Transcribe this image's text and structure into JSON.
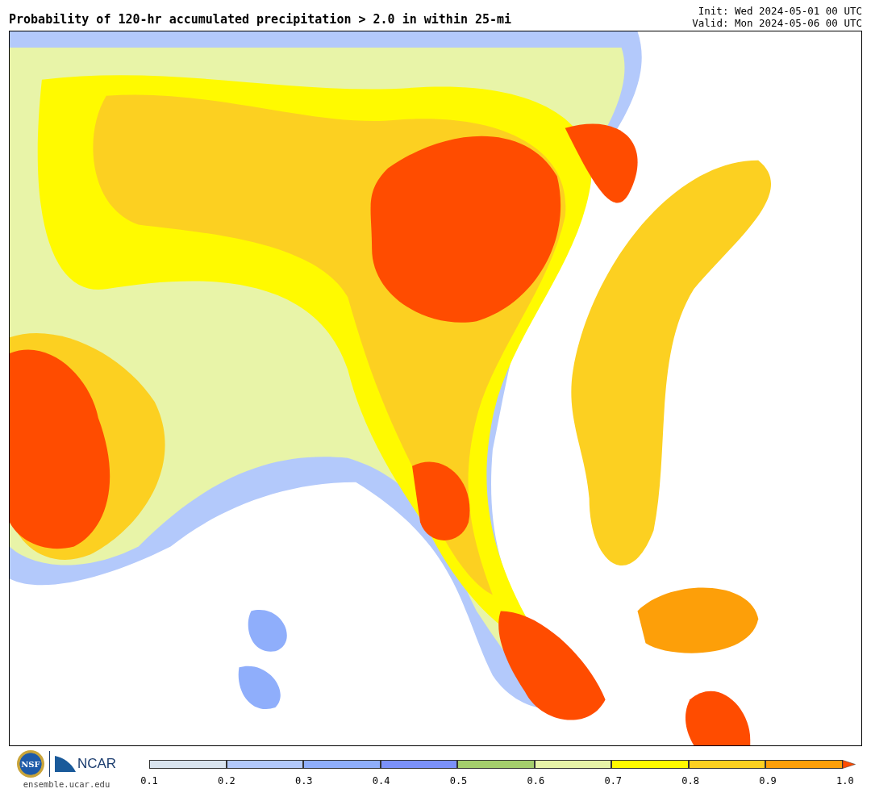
{
  "title": "Probability of 120-hr accumulated precipitation > 2.0 in within 25-mi",
  "init": "Init: Wed 2024-05-01 00 UTC",
  "valid": "Valid: Mon 2024-05-06 00 UTC",
  "logos": {
    "nsf": "NSF",
    "ncar": "NCAR",
    "site": "ensemble.ucar.edu"
  },
  "colorbar": {
    "segments": [
      {
        "color": "#d9e4ef"
      },
      {
        "color": "#b3c9fb"
      },
      {
        "color": "#8faefb"
      },
      {
        "color": "#7b91f9"
      },
      {
        "color": "#a4ce6c"
      },
      {
        "color": "#e8f4a8"
      },
      {
        "color": "#fffa00"
      },
      {
        "color": "#fcd021"
      },
      {
        "color": "#fd9f09"
      }
    ],
    "extension": {
      "color": "#ff4c00"
    },
    "ticks": [
      "0.1",
      "0.2",
      "0.3",
      "0.4",
      "0.5",
      "0.6",
      "0.7",
      "0.8",
      "0.9",
      "1.0"
    ]
  }
}
